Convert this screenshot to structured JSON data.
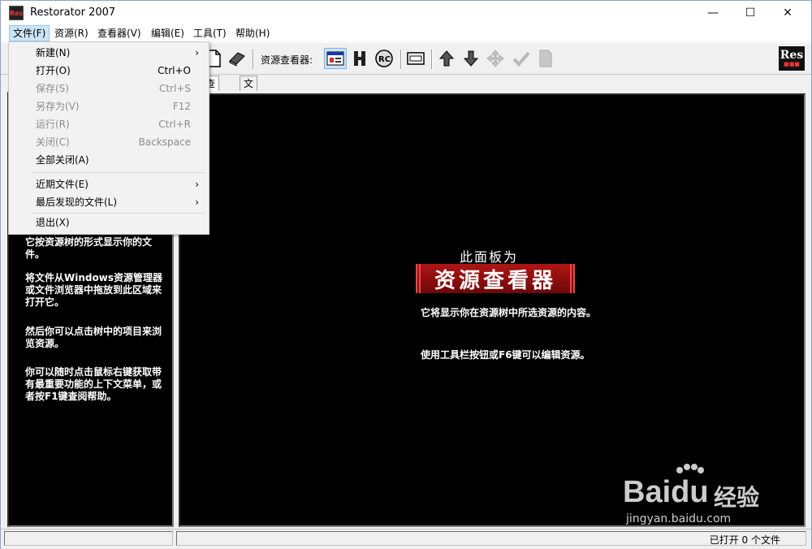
{
  "window": {
    "title": "Restorator 2007",
    "app_icon_text": "Res",
    "controls": {
      "minimize": "—",
      "maximize": "☐",
      "close": "✕"
    }
  },
  "menubar": {
    "items": [
      {
        "label": "文件(F)"
      },
      {
        "label": "资源(R)"
      },
      {
        "label": "查看器(V)"
      },
      {
        "label": "编辑(E)"
      },
      {
        "label": "工具(T)"
      },
      {
        "label": "帮助(H)"
      }
    ]
  },
  "toolbar": {
    "viewer_label": "资源查看器:",
    "logo_text": "Res",
    "logo_sub": "■■■"
  },
  "tabs": [
    {
      "label": "查看器"
    },
    {
      "label": "文件浏览器"
    }
  ],
  "file_menu": {
    "items": [
      {
        "label": "新建(N)",
        "shortcut": "",
        "submenu": true,
        "disabled": false
      },
      {
        "label": "打开(O)",
        "shortcut": "Ctrl+O",
        "submenu": false,
        "disabled": false
      },
      {
        "label": "保存(S)",
        "shortcut": "Ctrl+S",
        "submenu": false,
        "disabled": true
      },
      {
        "label": "另存为(V)",
        "shortcut": "F12",
        "submenu": false,
        "disabled": true
      },
      {
        "label": "运行(R)",
        "shortcut": "Ctrl+R",
        "submenu": false,
        "disabled": true
      },
      {
        "label": "关闭(C)",
        "shortcut": "Backspace",
        "submenu": false,
        "disabled": true
      },
      {
        "label": "全部关闭(A)",
        "shortcut": "",
        "submenu": false,
        "disabled": false
      },
      {
        "label": "近期文件(E)",
        "shortcut": "",
        "submenu": true,
        "disabled": false
      },
      {
        "label": "最后发现的文件(L)",
        "shortcut": "",
        "submenu": true,
        "disabled": false
      },
      {
        "label": "退出(X)",
        "shortcut": "",
        "submenu": false,
        "disabled": false
      }
    ],
    "submenu_arrow": "›"
  },
  "left_panel": {
    "paragraphs": [
      "它按资源树的形式显示你的文件。",
      "将文件从Windows资源管理器或文件浏览器中拖放到此区域来打开它。",
      "然后你可以点击树中的项目来浏览资源。",
      "你可以随时点击鼠标右键获取带有最重要功能的上下文菜单，或者按F1键查阅帮助。"
    ]
  },
  "viewer_panel": {
    "small_title": "此面板为",
    "banner": "资源查看器",
    "paragraphs": [
      "它将显示你在资源树中所选资源的内容。",
      "使用工具栏按钮或F6键可以编辑资源。"
    ]
  },
  "statusbar": {
    "text": "已打开 0 个文件"
  },
  "watermark": {
    "brand": "Bai",
    "brand2": "du",
    "cn": "经验",
    "url": "jingyan.baidu.com"
  }
}
